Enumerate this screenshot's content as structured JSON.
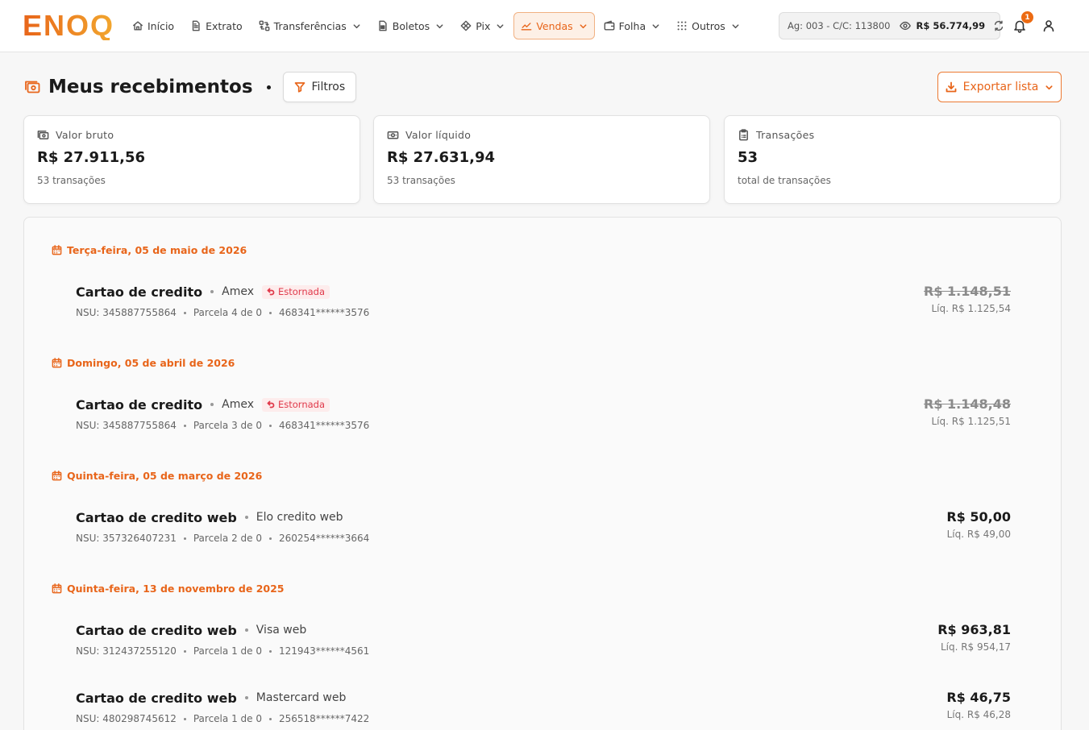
{
  "logo": "ENOQ",
  "nav": [
    {
      "label": "Início",
      "icon": "home-icon",
      "dropdown": false,
      "active": false
    },
    {
      "label": "Extrato",
      "icon": "document-icon",
      "dropdown": false,
      "active": false
    },
    {
      "label": "Transferências",
      "icon": "transfer-icon",
      "dropdown": true,
      "active": false
    },
    {
      "label": "Boletos",
      "icon": "barcode-document-icon",
      "dropdown": true,
      "active": false
    },
    {
      "label": "Pix",
      "icon": "pix-icon",
      "dropdown": true,
      "active": false
    },
    {
      "label": "Vendas",
      "icon": "chart-line-icon",
      "dropdown": true,
      "active": true
    },
    {
      "label": "Folha",
      "icon": "wallet-icon",
      "dropdown": true,
      "active": false
    },
    {
      "label": "Outros",
      "icon": "grid-dots-icon",
      "dropdown": true,
      "active": false
    }
  ],
  "account": {
    "info": "Ag: 003 - C/C: 113800",
    "balance": "R$ 56.774,99"
  },
  "notifications": {
    "count": "1"
  },
  "page": {
    "title": "Meus recebimentos",
    "filter_label": "Filtros",
    "export_label": "Exportar lista"
  },
  "cards": [
    {
      "label": "Valor bruto",
      "value": "R$ 27.911,56",
      "sub": "53 transações",
      "icon": "money-icon"
    },
    {
      "label": "Valor líquido",
      "value": "R$ 27.631,94",
      "sub": "53 transações",
      "icon": "banknote-icon"
    },
    {
      "label": "Transações",
      "value": "53",
      "sub": "total de transações",
      "icon": "clipboard-icon"
    }
  ],
  "groups": [
    {
      "date": "Terça-feira, 05 de maio de 2026",
      "transactions": [
        {
          "title": "Cartao de credito",
          "brand": "Amex",
          "status": "Estornada",
          "nsu": "NSU: 345887755864",
          "parcel": "Parcela 4 de 0",
          "card": "468341******3576",
          "gross": "R$ 1.148,51",
          "net": "Líq. R$ 1.125,54"
        }
      ]
    },
    {
      "date": "Domingo, 05 de abril de 2026",
      "transactions": [
        {
          "title": "Cartao de credito",
          "brand": "Amex",
          "status": "Estornada",
          "nsu": "NSU: 345887755864",
          "parcel": "Parcela 3 de 0",
          "card": "468341******3576",
          "gross": "R$ 1.148,48",
          "net": "Líq. R$ 1.125,51"
        }
      ]
    },
    {
      "date": "Quinta-feira, 05 de março de 2026",
      "transactions": [
        {
          "title": "Cartao de credito web",
          "brand": "Elo credito web",
          "status": "",
          "nsu": "NSU: 357326407231",
          "parcel": "Parcela 2 de 0",
          "card": "260254******3664",
          "gross": "R$ 50,00",
          "net": "Líq. R$ 49,00"
        }
      ]
    },
    {
      "date": "Quinta-feira, 13 de novembro de 2025",
      "transactions": [
        {
          "title": "Cartao de credito web",
          "brand": "Visa web",
          "status": "",
          "nsu": "NSU: 312437255120",
          "parcel": "Parcela 1 de 0",
          "card": "121943******4561",
          "gross": "R$ 963,81",
          "net": "Líq. R$ 954,17"
        },
        {
          "title": "Cartao de credito web",
          "brand": "Mastercard web",
          "status": "",
          "nsu": "NSU: 480298745612",
          "parcel": "Parcela 1 de 0",
          "card": "256518******7422",
          "gross": "R$ 46,75",
          "net": "Líq. R$ 46,28"
        }
      ]
    }
  ],
  "colors": {
    "accent": "#e8651a",
    "refund": "#e0394a"
  }
}
